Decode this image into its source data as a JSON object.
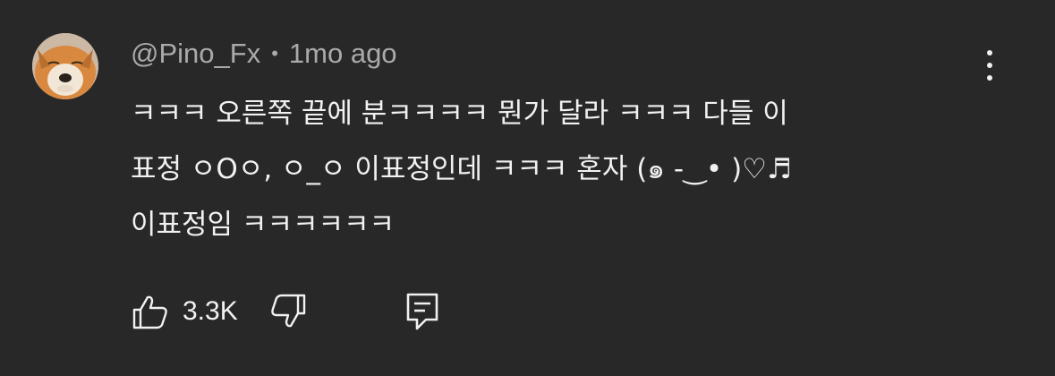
{
  "comment": {
    "author": "@Pino_Fx",
    "separator": "•",
    "time_ago": "1mo ago",
    "lines": [
      "ㅋㅋㅋ 오른쪽 끝에 분ㅋㅋㅋㅋ 뭔가 달라 ㅋㅋㅋ 다들 이",
      "표정 ㅇOㅇ, ㅇ_ㅇ 이표정인데 ㅋㅋㅋ 혼자 (๑ -‿• )♡♬",
      "이표정임 ㅋㅋㅋㅋㅋㅋ"
    ],
    "like_count": "3.3K"
  },
  "icons": {
    "avatar": "fox-avatar",
    "more": "more-vertical-icon",
    "like": "thumbs-up-icon",
    "dislike": "thumbs-down-icon",
    "reply": "reply-comment-icon"
  },
  "colors": {
    "background": "#282828",
    "text": "#f1f1f1",
    "secondary_text": "#aaaaaa"
  }
}
